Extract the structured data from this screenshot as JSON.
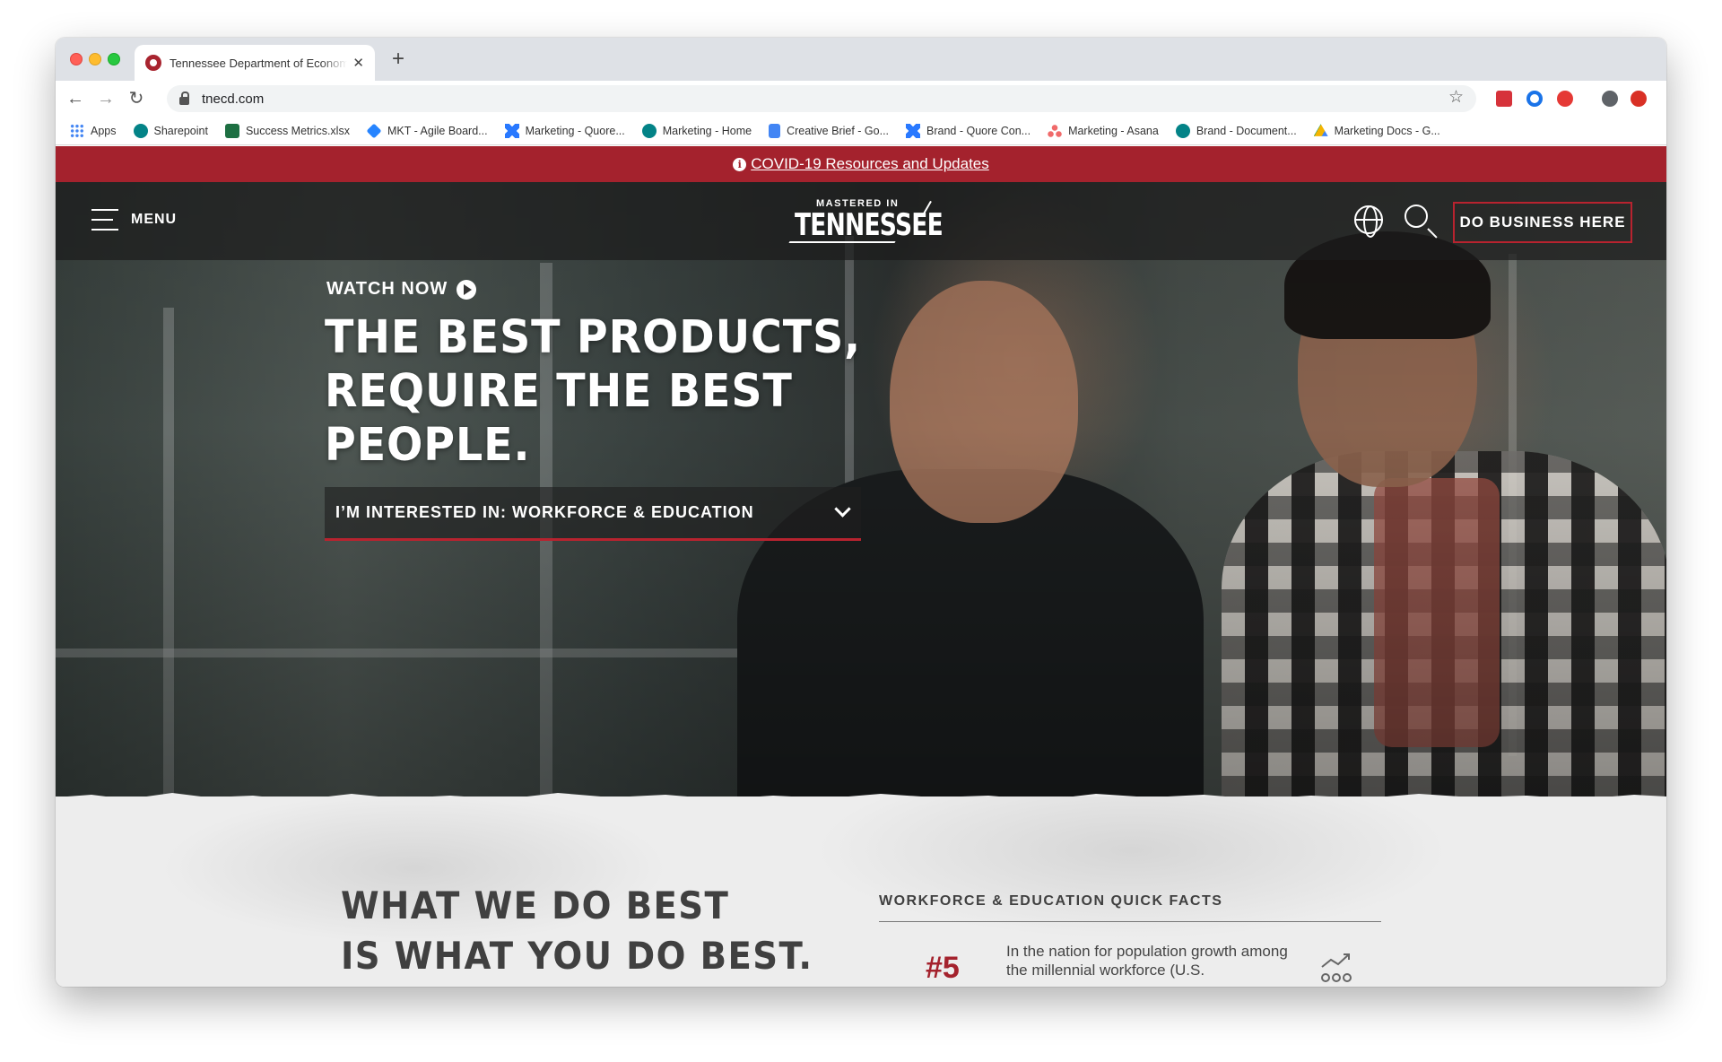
{
  "browser": {
    "tab_title": "Tennessee Department of Economic",
    "new_tab_symbol": "+",
    "close_symbol": "✕",
    "url": "tnecd.com",
    "bookmarks": [
      {
        "label": "Apps",
        "icon": "apps-grid-icon"
      },
      {
        "label": "Sharepoint",
        "icon": "sharepoint-icon"
      },
      {
        "label": "Success Metrics.xlsx",
        "icon": "excel-icon"
      },
      {
        "label": "MKT - Agile Board...",
        "icon": "jira-icon"
      },
      {
        "label": "Marketing - Quore...",
        "icon": "quore-icon"
      },
      {
        "label": "Marketing - Home",
        "icon": "sharepoint-icon"
      },
      {
        "label": "Creative Brief - Go...",
        "icon": "google-docs-icon"
      },
      {
        "label": "Brand - Quore Con...",
        "icon": "quore-icon"
      },
      {
        "label": "Marketing - Asana",
        "icon": "asana-icon"
      },
      {
        "label": "Brand - Document...",
        "icon": "sharepoint-icon"
      },
      {
        "label": "Marketing Docs - G...",
        "icon": "google-drive-icon"
      }
    ]
  },
  "site": {
    "covid_banner": "COVID-19 Resources and Updates",
    "menu_label": "MENU",
    "logo_top": "MASTERED IN",
    "logo_main": "TENNESSEE",
    "cta_label": "DO BUSINESS HERE",
    "accent_color": "#a4222d"
  },
  "hero": {
    "watch_label": "WATCH NOW",
    "headline": [
      "THE BEST PRODUCTS,",
      "REQUIRE THE BEST",
      "PEOPLE."
    ],
    "interest_label": "I’M INTERESTED IN: WORKFORCE & EDUCATION"
  },
  "lower": {
    "title": [
      "WHAT WE DO BEST",
      "IS WHAT YOU DO BEST."
    ],
    "facts_heading": "WORKFORCE & EDUCATION QUICK FACTS",
    "fact_rank": "#5",
    "fact_desc": "In the nation for population growth among the millennial workforce (U.S."
  }
}
